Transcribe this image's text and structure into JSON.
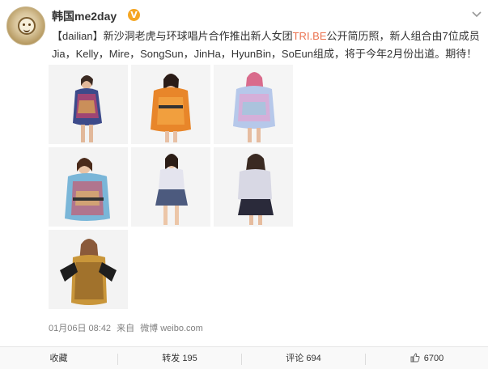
{
  "post": {
    "username": "韩国me2day",
    "verified_badge": "V",
    "text_topic": "【dailian】",
    "text_part1": "新沙洞老虎与环球唱片合作推出新人女团",
    "text_link": "TRI.BE",
    "text_part2": "公开简历照，新人组合由7位成员Jia，Kelly，Mire，SongSun，JinHa，HyunBin，SoEun组成，将于今年2月份出道。期待！",
    "timestamp": "01月06日 08:42",
    "source_prefix": "来自",
    "source": "微博 weibo.com",
    "photo_count": 7
  },
  "actions": {
    "collect": "收藏",
    "repost_label": "转发",
    "repost_count": "195",
    "comment_label": "评论",
    "comment_count": "694",
    "like_count": "6700"
  },
  "icons": {
    "more": "chevron-down-icon",
    "like": "thumbs-up-icon",
    "avatar": "avatar-image"
  },
  "colors": {
    "link": "#eb7350",
    "verified": "#f5a623",
    "text": "#333333",
    "meta": "#808080"
  }
}
